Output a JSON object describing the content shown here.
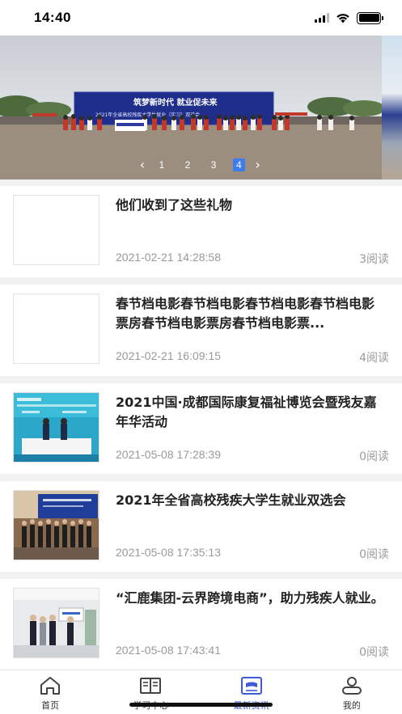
{
  "status_bar": {
    "time": "14:40",
    "icons": [
      "cellular-signal-icon",
      "wifi-icon",
      "battery-icon"
    ]
  },
  "banner": {
    "image": "campus-event-photo",
    "stage_slogan": "筑梦新时代 就业促未来",
    "stage_subtitle": "2021年全省高校残疾大学生就业（实习）双选会",
    "pager": {
      "prev_icon": "chevron-left-icon",
      "next_icon": "chevron-right-icon",
      "pages": [
        "1",
        "2",
        "3",
        "4"
      ],
      "active_page": "4"
    }
  },
  "news": [
    {
      "title": "他们收到了这些礼物",
      "date": "2021-02-21 14:28:58",
      "reads": "3阅读",
      "thumb": "blank"
    },
    {
      "title": "春节档电影春节档电影春节档电影春节档电影票房春节档电影票房春节档电影票...",
      "date": "2021-02-21 16:09:15",
      "reads": "4阅读",
      "thumb": "blank"
    },
    {
      "title": "2021中国·成都国际康复福祉博览会暨残友嘉年华活动",
      "date": "2021-05-08 17:28:39",
      "reads": "0阅读",
      "thumb": "signing-ceremony-photo"
    },
    {
      "title": "2021年全省高校残疾大学生就业双选会",
      "date": "2021-05-08 17:35:13",
      "reads": "0阅读",
      "thumb": "group-photo"
    },
    {
      "title": "“汇鹿集团-云界跨境电商”，助力残疾人就业。",
      "date": "2021-05-08 17:43:41",
      "reads": "0阅读",
      "thumb": "office-photo"
    }
  ],
  "tabs": [
    {
      "label": "首页",
      "icon": "home-icon"
    },
    {
      "label": "学习中心",
      "icon": "book-icon"
    },
    {
      "label": "最新资讯",
      "icon": "news-icon",
      "active": true
    },
    {
      "label": "我的",
      "icon": "profile-icon"
    }
  ],
  "colors": {
    "accent": "#3d5bd6",
    "pager_active": "#3d7cf0",
    "muted_text": "#9a9a9a"
  }
}
